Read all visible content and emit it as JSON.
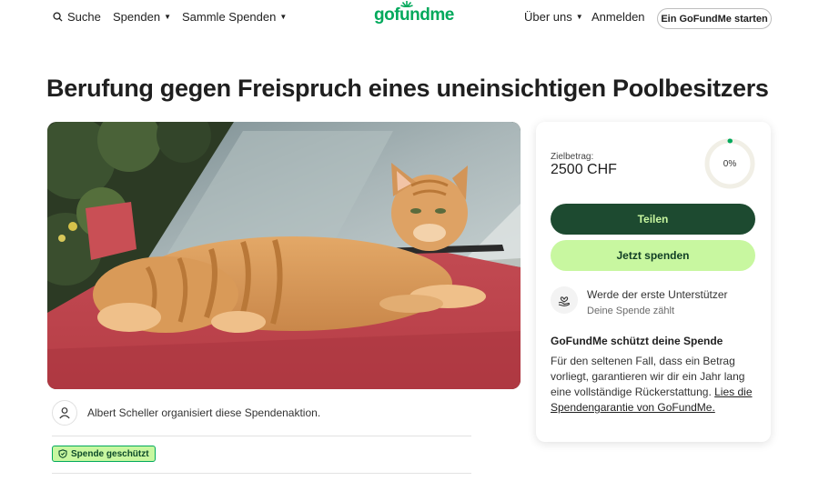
{
  "header": {
    "search_label": "Suche",
    "donate_label": "Spenden",
    "collect_label": "Sammle Spenden",
    "logo_text": "gofundme",
    "about_label": "Über uns",
    "login_label": "Anmelden",
    "start_label": "Ein GoFundMe starten",
    "brand_color": "#02a95c"
  },
  "campaign": {
    "title": "Berufung gegen Freispruch eines uneinsichtigen Poolbesitzers",
    "organizer_text": "Albert Scheller organisiert diese Spendenaktion.",
    "protected_badge": "Spende geschützt"
  },
  "donation_card": {
    "goal_label": "Zielbetrag:",
    "goal_amount": "2500 CHF",
    "progress_text": "0%",
    "progress_fraction": 0,
    "share_label": "Teilen",
    "donate_label": "Jetzt spenden",
    "supporter_main": "Werde der erste Unterstützer",
    "supporter_sub": "Deine Spende zählt",
    "guarantee_title": "GoFundMe schützt deine Spende",
    "guarantee_text": "Für den seltenen Fall, dass ein Betrag vorliegt, garantieren wir dir ein Jahr lang eine vollständige Rückerstattung.",
    "guarantee_link": "Lies die Spendengarantie von GoFundMe.",
    "share_color": "#1d4a30",
    "donate_color": "#c8f7a0"
  },
  "icons": {
    "search": "search-icon",
    "caret": "chevron-down-icon",
    "user": "user-icon",
    "heart_hand": "heart-hand-icon",
    "shield": "shield-icon"
  }
}
